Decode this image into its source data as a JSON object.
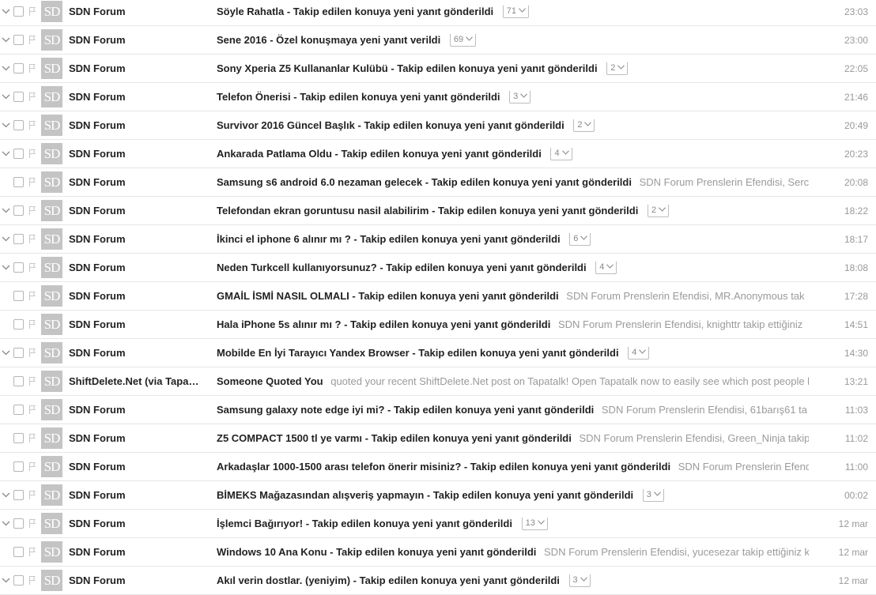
{
  "avatar_text": "SD",
  "messages": [
    {
      "sender": "SDN Forum",
      "subject": "Söyle Rahatla - Takip edilen konuya yeni yanıt gönderildi",
      "snippet": "",
      "count": "71",
      "time": "23:03",
      "expandable": true
    },
    {
      "sender": "SDN Forum",
      "subject": "Sene 2016 - Özel konuşmaya yeni yanıt verildi",
      "snippet": "",
      "count": "69",
      "time": "23:00",
      "expandable": true
    },
    {
      "sender": "SDN Forum",
      "subject": "Sony Xperia Z5 Kullananlar Kulübü - Takip edilen konuya yeni yanıt gönderildi",
      "snippet": "",
      "count": "2",
      "time": "22:05",
      "expandable": true
    },
    {
      "sender": "SDN Forum",
      "subject": "Telefon Önerisi - Takip edilen konuya yeni yanıt gönderildi",
      "snippet": "",
      "count": "3",
      "time": "21:46",
      "expandable": true
    },
    {
      "sender": "SDN Forum",
      "subject": "Survivor 2016 Güncel Başlık - Takip edilen konuya yeni yanıt gönderildi",
      "snippet": "",
      "count": "2",
      "time": "20:49",
      "expandable": true
    },
    {
      "sender": "SDN Forum",
      "subject": "Ankarada Patlama Oldu - Takip edilen konuya yeni yanıt gönderildi",
      "snippet": "",
      "count": "4",
      "time": "20:23",
      "expandable": true
    },
    {
      "sender": "SDN Forum",
      "subject": "Samsung s6 android 6.0 nezaman gelecek - Takip edilen konuya yeni yanıt gönderildi",
      "snippet": "SDN Forum Prenslerin Efendisi, Serc",
      "count": "",
      "time": "20:08",
      "expandable": false
    },
    {
      "sender": "SDN Forum",
      "subject": "Telefondan ekran goruntusu nasil alabilirim - Takip edilen konuya yeni yanıt gönderildi",
      "snippet": "",
      "count": "2",
      "time": "18:22",
      "expandable": true
    },
    {
      "sender": "SDN Forum",
      "subject": "İkinci el iphone 6 alınır mı ? - Takip edilen konuya yeni yanıt gönderildi",
      "snippet": "",
      "count": "6",
      "time": "18:17",
      "expandable": true
    },
    {
      "sender": "SDN Forum",
      "subject": "Neden Turkcell kullanıyorsunuz? - Takip edilen konuya yeni yanıt gönderildi",
      "snippet": "",
      "count": "4",
      "time": "18:08",
      "expandable": true
    },
    {
      "sender": "SDN Forum",
      "subject": "GMAİL İSMİ NASIL OLMALI - Takip edilen konuya yeni yanıt gönderildi",
      "snippet": "SDN Forum Prenslerin Efendisi, MR.Anonymous tak",
      "count": "",
      "time": "17:28",
      "expandable": false
    },
    {
      "sender": "SDN Forum",
      "subject": "Hala iPhone 5s alınır mı ? - Takip edilen konuya yeni yanıt gönderildi",
      "snippet": "SDN Forum Prenslerin Efendisi, knighttr takip ettiğiniz",
      "count": "",
      "time": "14:51",
      "expandable": false
    },
    {
      "sender": "SDN Forum",
      "subject": "Mobilde En İyi Tarayıcı Yandex Browser - Takip edilen konuya yeni yanıt gönderildi",
      "snippet": "",
      "count": "4",
      "time": "14:30",
      "expandable": true
    },
    {
      "sender": "ShiftDelete.Net (via Tapa…",
      "subject": "Someone Quoted You",
      "snippet": "quoted your recent ShiftDelete.Net post on Tapatalk! Open Tapatalk now to easily see which post people l",
      "count": "",
      "time": "13:21",
      "expandable": false
    },
    {
      "sender": "SDN Forum",
      "subject": "Samsung galaxy note edge iyi mi? - Takip edilen konuya yeni yanıt gönderildi",
      "snippet": "SDN Forum Prenslerin Efendisi, 61barış61 ta",
      "count": "",
      "time": "11:03",
      "expandable": false
    },
    {
      "sender": "SDN Forum",
      "subject": "Z5 COMPACT 1500 tl ye varmı - Takip edilen konuya yeni yanıt gönderildi",
      "snippet": "SDN Forum Prenslerin Efendisi, Green_Ninja takip",
      "count": "",
      "time": "11:02",
      "expandable": false
    },
    {
      "sender": "SDN Forum",
      "subject": "Arkadaşlar 1000-1500 arası telefon önerir misiniz? - Takip edilen konuya yeni yanıt gönderildi",
      "snippet": "SDN Forum Prenslerin Efend",
      "count": "",
      "time": "11:00",
      "expandable": false
    },
    {
      "sender": "SDN Forum",
      "subject": "BİMEKS Mağazasından alışveriş yapmayın - Takip edilen konuya yeni yanıt gönderildi",
      "snippet": "",
      "count": "3",
      "time": "00:02",
      "expandable": true
    },
    {
      "sender": "SDN Forum",
      "subject": "İşlemci Bağırıyor! - Takip edilen konuya yeni yanıt gönderildi",
      "snippet": "",
      "count": "13",
      "time": "12 mar",
      "expandable": true
    },
    {
      "sender": "SDN Forum",
      "subject": "Windows 10 Ana Konu - Takip edilen konuya yeni yanıt gönderildi",
      "snippet": "SDN Forum Prenslerin Efendisi, yucesezar takip ettiğiniz k",
      "count": "",
      "time": "12 mar",
      "expandable": false
    },
    {
      "sender": "SDN Forum",
      "subject": "Akıl verin dostlar. (yeniyim) - Takip edilen konuya yeni yanıt gönderildi",
      "snippet": "",
      "count": "3",
      "time": "12 mar",
      "expandable": true
    }
  ],
  "colors": {
    "avatar_bg": "#c4c4c4",
    "snippet_text": "#9a9a9a",
    "time_text": "#999999",
    "row_divider": "#e6e6e6"
  },
  "icons": {
    "expander": "chevron-down-icon",
    "flag": "flag-icon",
    "badge_caret": "chevron-down-icon"
  }
}
